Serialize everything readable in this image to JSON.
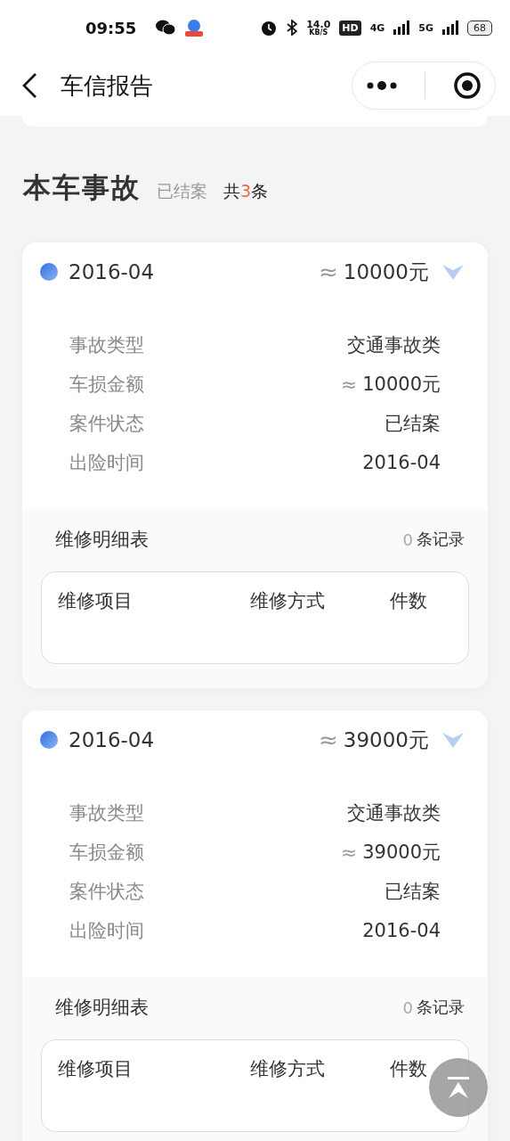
{
  "status_bar": {
    "time": "09:55",
    "speed_value": "14.0",
    "speed_unit": "KB/S",
    "hd": "HD",
    "network_1": "4G",
    "network_2": "5G",
    "battery": "68"
  },
  "nav": {
    "title": "车信报告"
  },
  "section": {
    "title": "本车事故",
    "status": "已结案",
    "count_prefix": "共",
    "count": "3",
    "count_suffix": "条"
  },
  "accidents": [
    {
      "date": "2016-04",
      "approx": "≈",
      "amount": "10000元",
      "details": [
        {
          "label": "事故类型",
          "value": "交通事故类"
        },
        {
          "label": "车损金额",
          "approx": "≈",
          "value": "10000元"
        },
        {
          "label": "案件状态",
          "value": "已结案"
        },
        {
          "label": "出险时间",
          "value": "2016-04"
        }
      ],
      "repair": {
        "title": "维修明细表",
        "count": "0",
        "count_suffix": "条记录",
        "columns": [
          "维修项目",
          "维修方式",
          "件数"
        ]
      }
    },
    {
      "date": "2016-04",
      "approx": "≈",
      "amount": "39000元",
      "details": [
        {
          "label": "事故类型",
          "value": "交通事故类"
        },
        {
          "label": "车损金额",
          "approx": "≈",
          "value": "39000元"
        },
        {
          "label": "案件状态",
          "value": "已结案"
        },
        {
          "label": "出险时间",
          "value": "2016-04"
        }
      ],
      "repair": {
        "title": "维修明细表",
        "count": "0",
        "count_suffix": "条记录",
        "columns": [
          "维修项目",
          "维修方式",
          "件数"
        ]
      }
    }
  ]
}
